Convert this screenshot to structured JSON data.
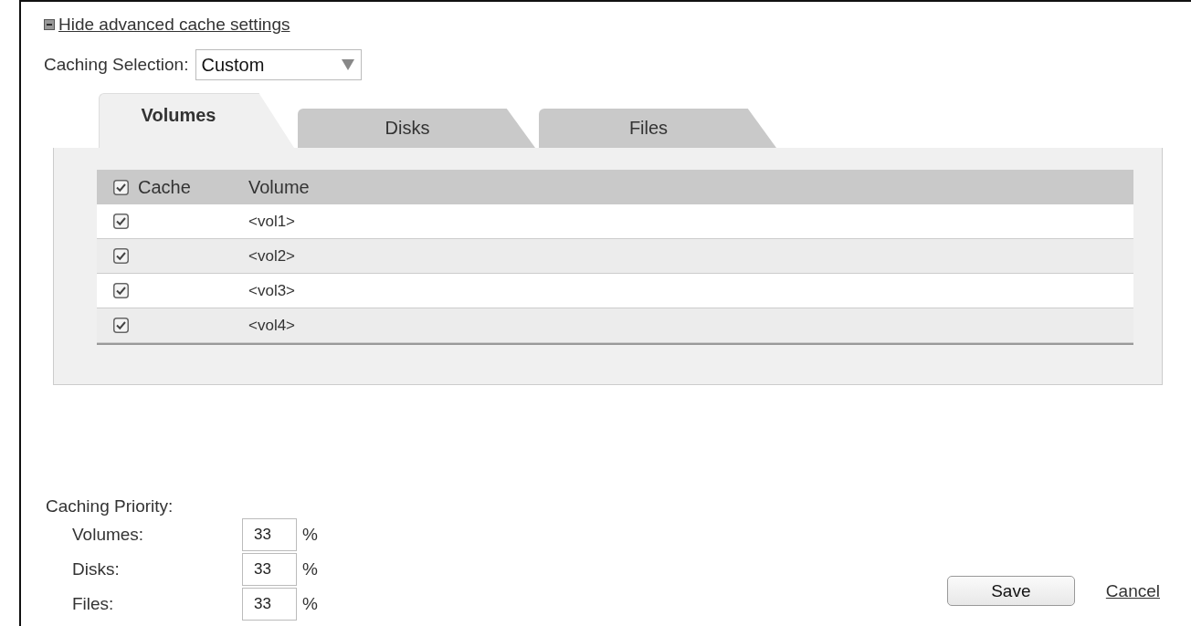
{
  "toggle_link": {
    "label": "Hide advanced cache settings",
    "expanded": true
  },
  "caching_selection": {
    "label": "Caching Selection:",
    "value": "Custom"
  },
  "tabs": [
    {
      "label": "Volumes",
      "selected": true
    },
    {
      "label": "Disks",
      "selected": false
    },
    {
      "label": "Files",
      "selected": false
    }
  ],
  "table": {
    "columns": [
      {
        "label": "Cache",
        "checked": true
      },
      {
        "label": "Volume"
      }
    ],
    "rows": [
      {
        "checked": true,
        "volume": "<vol1>"
      },
      {
        "checked": true,
        "volume": "<vol2>"
      },
      {
        "checked": true,
        "volume": "<vol3>"
      },
      {
        "checked": true,
        "volume": "<vol4>"
      }
    ]
  },
  "caching_priority": {
    "label": "Caching Priority:",
    "items": [
      {
        "label": "Volumes:",
        "value": "33",
        "unit": "%"
      },
      {
        "label": "Disks:",
        "value": "33",
        "unit": "%"
      },
      {
        "label": "Files:",
        "value": "33",
        "unit": "%"
      }
    ]
  },
  "buttons": {
    "save": "Save",
    "cancel": "Cancel"
  }
}
